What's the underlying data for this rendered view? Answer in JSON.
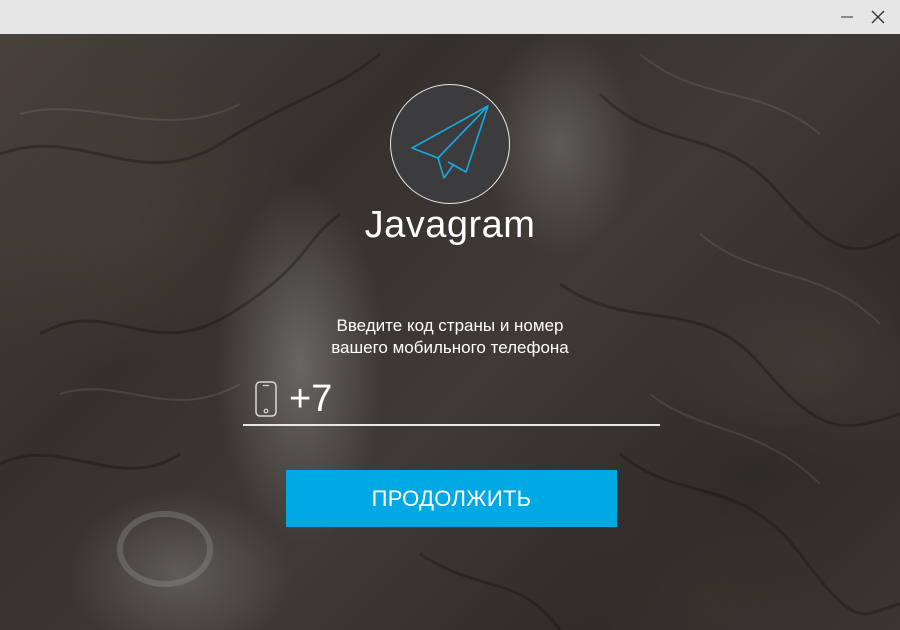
{
  "window": {
    "title_buttons": [
      "minimize",
      "close"
    ]
  },
  "app": {
    "name": "Javagram",
    "logo_icon": "paper-plane-icon",
    "accent_color": "#01a9e4"
  },
  "login": {
    "instruction_line1": "Введите код страны и номер",
    "instruction_line2": "вашего мобильного телефона",
    "phone_value": "+7",
    "phone_icon": "smartphone-icon",
    "continue_label": "ПРОДОЛЖИТЬ"
  }
}
